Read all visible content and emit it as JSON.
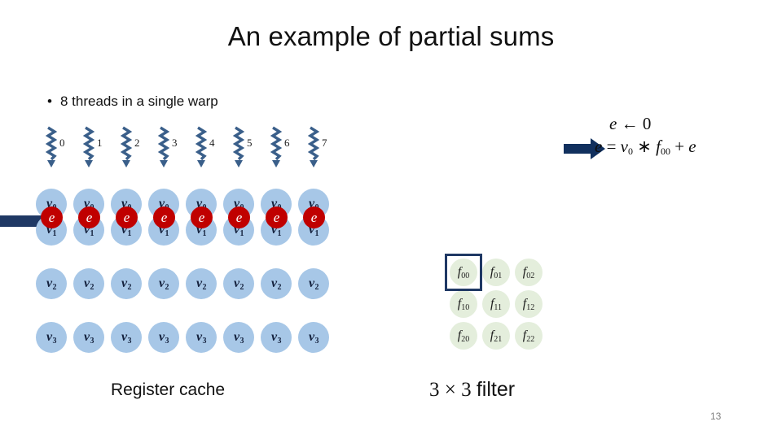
{
  "slide": {
    "title": "An example of partial sums",
    "page_number": "13"
  },
  "bullets": [
    {
      "marker": "•",
      "text": "8 threads in a single warp"
    }
  ],
  "threads": {
    "arrow_icon": "squiggly-down-arrow-icon",
    "arrow_color": "#3A5F8A",
    "labels": [
      "0",
      "1",
      "2",
      "3",
      "4",
      "5",
      "6",
      "7"
    ]
  },
  "register_cache": {
    "caption": "Register cache",
    "cell_color": "#A7C7E7",
    "accent_color": "#C00000",
    "row_labels": [
      "v",
      "v",
      "v",
      "v"
    ],
    "row_subscripts": [
      "0",
      "1",
      "2",
      "3"
    ],
    "columns": 8,
    "highlight_label": "e",
    "highlight_row": 0,
    "left_arrow_icon": "block-right-arrow-icon",
    "left_arrow_color": "#1F3864"
  },
  "equations": {
    "arrow_icon": "block-right-arrow-icon",
    "arrow_color": "#11305E",
    "line1": {
      "lhs": "e",
      "op": "←",
      "rhs": "0"
    },
    "line2": {
      "lhs": "e",
      "eq": "=",
      "term1": "v",
      "term1_sub": "0",
      "mul": "∗",
      "term2": "f",
      "term2_sub": "00",
      "plus": "+",
      "term3": "e"
    }
  },
  "filter": {
    "caption_prefix": "3 × 3",
    "caption_suffix": "filter",
    "cell_color": "#E4EEDC",
    "highlight_color": "#1F3864",
    "highlighted_cell": "f00",
    "rows": [
      [
        {
          "base": "f",
          "sub": "00"
        },
        {
          "base": "f",
          "sub": "01"
        },
        {
          "base": "f",
          "sub": "02"
        }
      ],
      [
        {
          "base": "f",
          "sub": "10"
        },
        {
          "base": "f",
          "sub": "11"
        },
        {
          "base": "f",
          "sub": "12"
        }
      ],
      [
        {
          "base": "f",
          "sub": "20"
        },
        {
          "base": "f",
          "sub": "21"
        },
        {
          "base": "f",
          "sub": "22"
        }
      ]
    ]
  }
}
